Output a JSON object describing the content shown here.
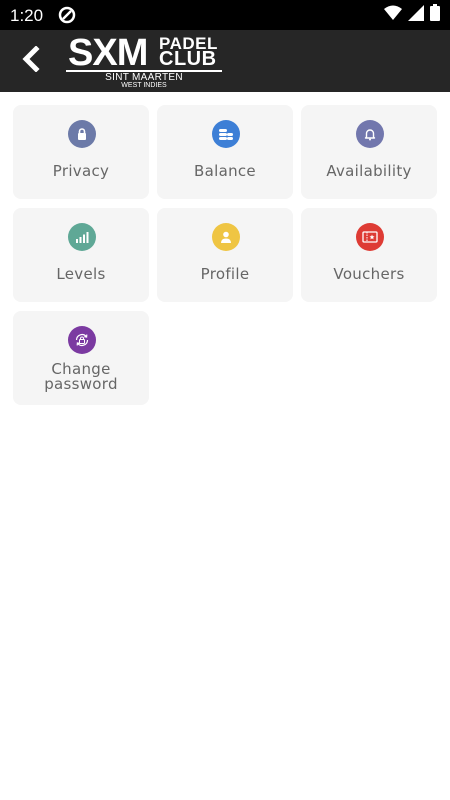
{
  "status_bar": {
    "time": "1:20",
    "left_icon": "data-saver-icon",
    "right_icons": [
      "wifi-icon",
      "signal-icon",
      "battery-icon"
    ]
  },
  "app_bar": {
    "back_icon": "chevron-left-icon",
    "logo": {
      "main": "SXM",
      "line1": "PADEL",
      "line2": "CLUB",
      "tagline": "SINT MAARTEN",
      "subtagline": "WEST INDIES"
    }
  },
  "tiles": [
    {
      "label": "Privacy",
      "icon": "lock-icon",
      "color": "#6c7aa8"
    },
    {
      "label": "Balance",
      "icon": "coins-icon",
      "color": "#3d7fd6"
    },
    {
      "label": "Availability",
      "icon": "bell-icon",
      "color": "#7277ad"
    },
    {
      "label": "Levels",
      "icon": "signal-bars-icon",
      "color": "#5fa896"
    },
    {
      "label": "Profile",
      "icon": "user-icon",
      "color": "#efc543"
    },
    {
      "label": "Vouchers",
      "icon": "ticket-icon",
      "color": "#de3b34"
    },
    {
      "label": "Change password",
      "icon": "lock-refresh-icon",
      "color": "#7b3aa1"
    }
  ]
}
